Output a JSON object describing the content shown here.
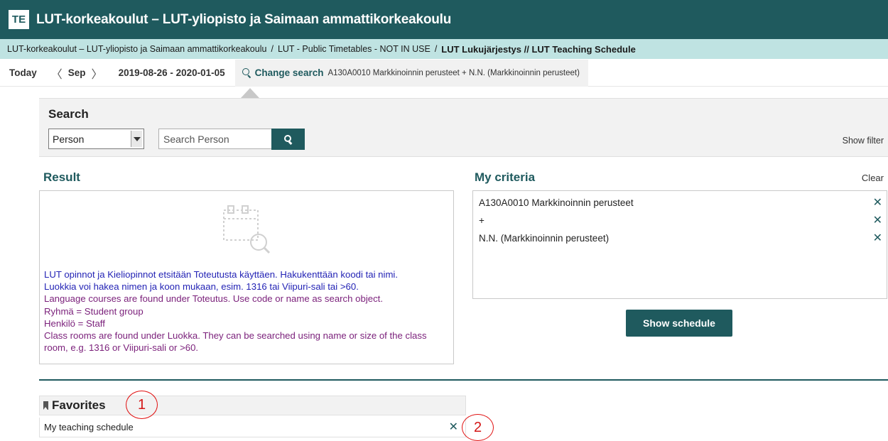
{
  "header": {
    "logo_text": "TE",
    "title": "LUT-korkeakoulut – LUT-yliopisto ja Saimaan ammattikorkeakoulu"
  },
  "breadcrumb": {
    "items": [
      "LUT-korkeakoulut – LUT-yliopisto ja Saimaan ammattikorkeakoulu",
      "LUT - Public Timetables - NOT IN USE",
      "LUT Lukujärjestys // LUT Teaching Schedule"
    ],
    "separator": "/"
  },
  "navbar": {
    "today_label": "Today",
    "prev_icon": "chevron-left-icon",
    "month": "Sep",
    "next_icon": "chevron-right-icon",
    "date_range": "2019-08-26 - 2020-01-05",
    "change_search_label": "Change search",
    "criteria_summary": "A130A0010 Markkinoinnin perusteet + N.N. (Markkinoinnin perusteet)"
  },
  "search": {
    "title": "Search",
    "type_selected": "Person",
    "input_placeholder": "Search Person",
    "input_value": "",
    "show_filter_label": "Show filter"
  },
  "result": {
    "title": "Result",
    "icon": "search-document-icon",
    "info_lines": [
      {
        "text": "LUT opinnot ja Kieliopinnot etsitään Toteutusta käyttäen. Hakukenttään koodi tai nimi.",
        "color": "#2323b5"
      },
      {
        "text": "Luokkia voi hakea nimen ja koon mukaan, esim. 1316 tai Viipuri-sali tai >60.",
        "color": "#2323b5"
      },
      {
        "text": "Language courses are found under Toteutus. Use code or name as search object.",
        "color": "#7a1f7a"
      },
      {
        "text": "Ryhmä = Student group",
        "color": "#7a1f7a"
      },
      {
        "text": "Henkilö = Staff",
        "color": "#7a1f7a"
      },
      {
        "text": "Class rooms are found under Luokka. They can be searched using name or size of the class room, e.g. 1316 or Viipuri-sali or >60.",
        "color": "#7a1f7a"
      }
    ]
  },
  "criteria": {
    "title": "My criteria",
    "clear_label": "Clear",
    "items": [
      {
        "label": "A130A0010 Markkinoinnin perusteet"
      },
      {
        "label": "+"
      },
      {
        "label": "N.N. (Markkinoinnin perusteet)"
      }
    ],
    "remove_glyph": "✕",
    "show_schedule_label": "Show schedule"
  },
  "favorites": {
    "title": "Favorites",
    "icon": "bookmark-icon",
    "items": [
      {
        "label": "My teaching schedule"
      }
    ],
    "remove_glyph": "✕"
  },
  "annotations": {
    "callout_1": "1",
    "callout_2": "2",
    "color": "#e01010"
  },
  "colors": {
    "brand": "#1f5a5e",
    "breadcrumb_bg": "#bfe3e2",
    "info_blue": "#2323b5",
    "info_purple": "#7a1f7a"
  }
}
